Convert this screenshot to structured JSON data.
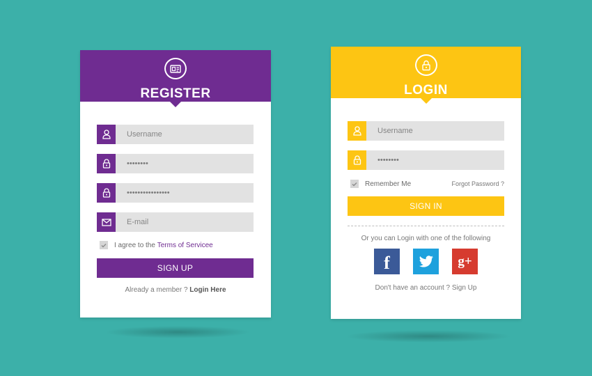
{
  "colors": {
    "background": "#3cb0a9",
    "register_accent": "#6f2c91",
    "login_accent": "#fdc513",
    "facebook": "#3b5a98",
    "twitter": "#1ea1dd",
    "google_plus": "#d63b2f"
  },
  "register": {
    "header_icon": "id-card-icon",
    "title": "REGISTER",
    "fields": [
      {
        "icon": "user-icon",
        "placeholder": "Username",
        "value": ""
      },
      {
        "icon": "lock-icon",
        "placeholder": "",
        "value": "••••••••"
      },
      {
        "icon": "lock-icon",
        "placeholder": "",
        "value": "••••••••••••••••"
      },
      {
        "icon": "envelope-icon",
        "placeholder": "E-mail",
        "value": ""
      }
    ],
    "agree_prefix": "I agree to the ",
    "agree_link": "Terms of Servicee",
    "submit_label": "SIGN UP",
    "footer_prefix": "Already a member ? ",
    "footer_link": "Login Here"
  },
  "login": {
    "header_icon": "lock-icon",
    "title": "LOGIN",
    "fields": [
      {
        "icon": "user-icon",
        "placeholder": "Username",
        "value": ""
      },
      {
        "icon": "lock-icon",
        "placeholder": "",
        "value": "••••••••"
      }
    ],
    "remember_label": "Remember Me",
    "forgot_label": "Forgot Password ?",
    "submit_label": "SIGN IN",
    "social_text": "Or you can Login with one of the following",
    "social": [
      {
        "name": "facebook",
        "glyph": "f"
      },
      {
        "name": "twitter",
        "glyph": ""
      },
      {
        "name": "google-plus",
        "glyph": "g+"
      }
    ],
    "footer_prefix": "Don't have an account ? ",
    "footer_link": "Sign Up"
  }
}
